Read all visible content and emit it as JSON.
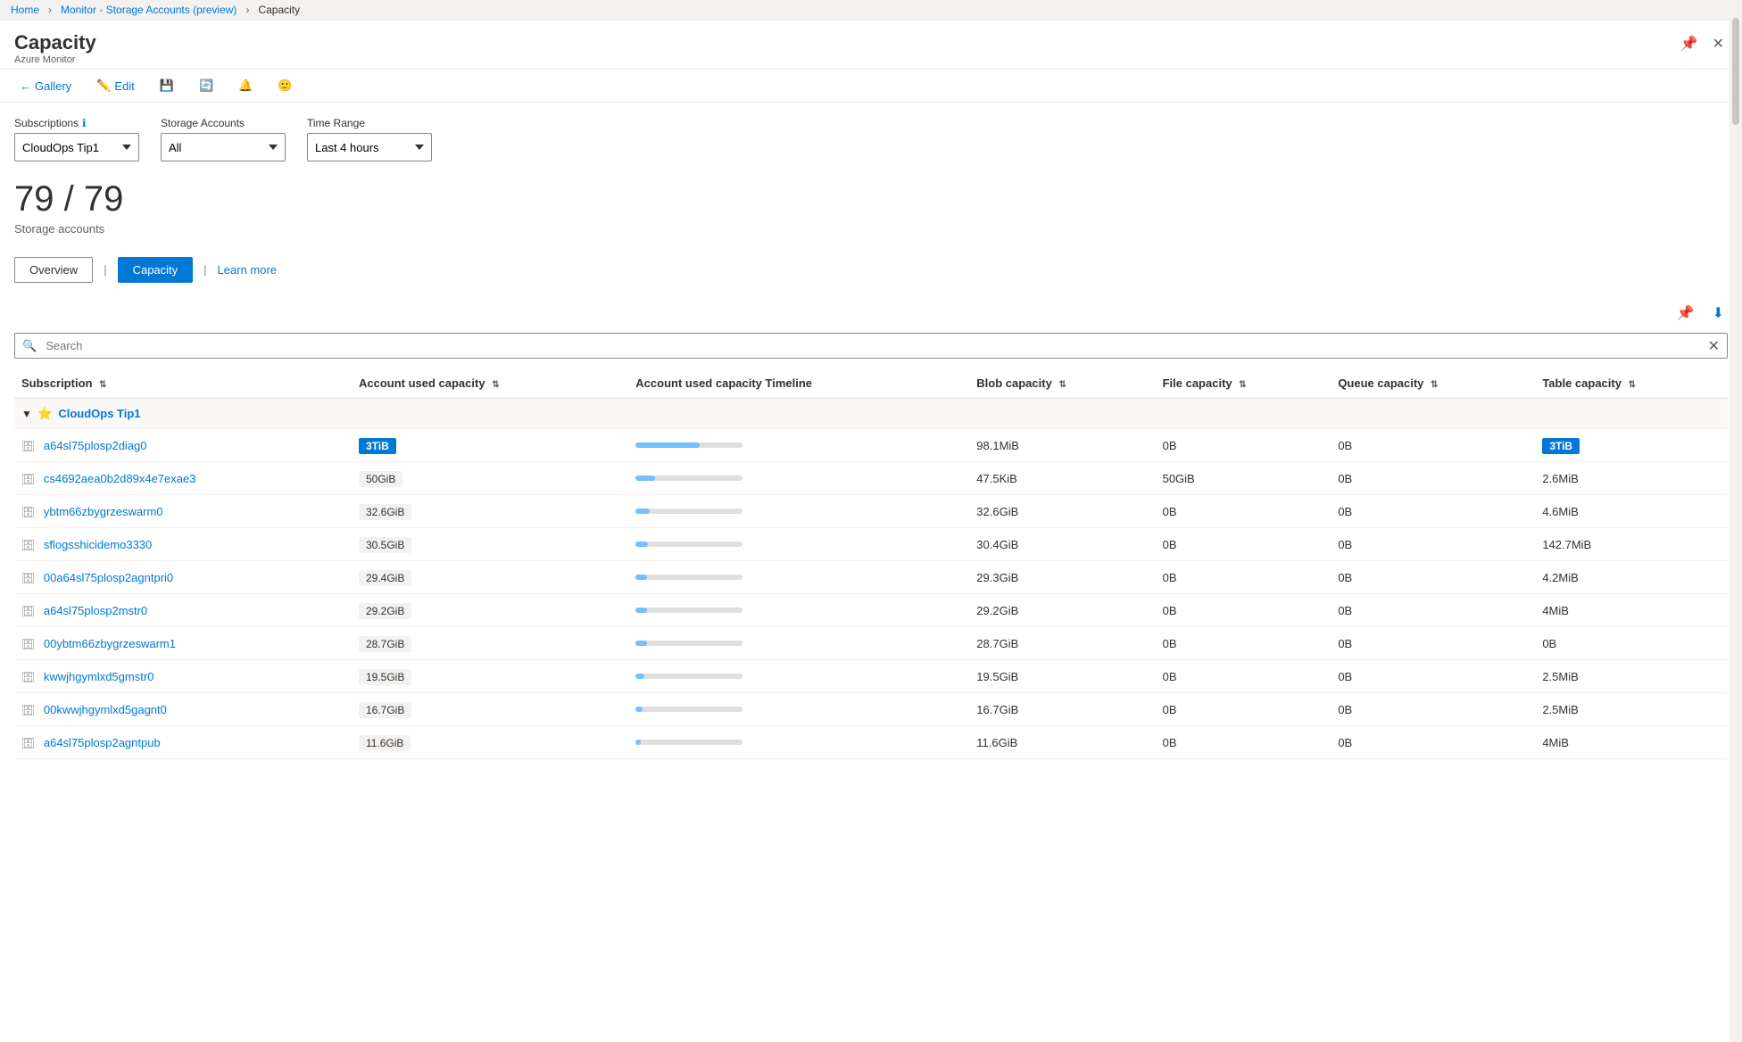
{
  "breadcrumb": {
    "home": "Home",
    "monitor": "Monitor - Storage Accounts (preview)",
    "current": "Capacity"
  },
  "header": {
    "title": "Capacity",
    "subtitle": "Azure Monitor"
  },
  "toolbar": {
    "gallery": "Gallery",
    "edit": "Edit"
  },
  "filters": {
    "subscriptions_label": "Subscriptions",
    "subscriptions_value": "CloudOps Tip1",
    "storage_accounts_label": "Storage Accounts",
    "storage_accounts_value": "All",
    "time_range_label": "Time Range",
    "time_range_value": "Last 4 hours"
  },
  "count": {
    "value": "79 / 79",
    "label": "Storage accounts"
  },
  "tabs": {
    "overview": "Overview",
    "capacity": "Capacity",
    "learn_more": "Learn more"
  },
  "search": {
    "placeholder": "Search"
  },
  "table": {
    "columns": [
      "Subscription",
      "Account used capacity",
      "Account used capacity Timeline",
      "Blob capacity",
      "File capacity",
      "Queue capacity",
      "Table capacity"
    ],
    "group": {
      "name": "CloudOps Tip1"
    },
    "rows": [
      {
        "name": "a64sl75plosp2diag0",
        "used_capacity": "3TiB",
        "used_capacity_highlight": true,
        "timeline_fill": 60,
        "blob_capacity": "98.1MiB",
        "file_capacity": "0B",
        "queue_capacity": "0B",
        "table_capacity": "3TiB",
        "table_capacity_highlight": true
      },
      {
        "name": "cs4692aea0b2d89x4e7exae3",
        "used_capacity": "50GiB",
        "used_capacity_highlight": false,
        "timeline_fill": 18,
        "blob_capacity": "47.5KiB",
        "file_capacity": "50GiB",
        "queue_capacity": "0B",
        "table_capacity": "2.6MiB",
        "table_capacity_highlight": false
      },
      {
        "name": "ybtm66zbygrzeswarm0",
        "used_capacity": "32.6GiB",
        "used_capacity_highlight": false,
        "timeline_fill": 13,
        "blob_capacity": "32.6GiB",
        "file_capacity": "0B",
        "queue_capacity": "0B",
        "table_capacity": "4.6MiB",
        "table_capacity_highlight": false
      },
      {
        "name": "sflogsshicidemo3330",
        "used_capacity": "30.5GiB",
        "used_capacity_highlight": false,
        "timeline_fill": 12,
        "blob_capacity": "30.4GiB",
        "file_capacity": "0B",
        "queue_capacity": "0B",
        "table_capacity": "142.7MiB",
        "table_capacity_highlight": false
      },
      {
        "name": "00a64sl75plosp2agntpri0",
        "used_capacity": "29.4GiB",
        "used_capacity_highlight": false,
        "timeline_fill": 11,
        "blob_capacity": "29.3GiB",
        "file_capacity": "0B",
        "queue_capacity": "0B",
        "table_capacity": "4.2MiB",
        "table_capacity_highlight": false
      },
      {
        "name": "a64sl75plosp2mstr0",
        "used_capacity": "29.2GiB",
        "used_capacity_highlight": false,
        "timeline_fill": 11,
        "blob_capacity": "29.2GiB",
        "file_capacity": "0B",
        "queue_capacity": "0B",
        "table_capacity": "4MiB",
        "table_capacity_highlight": false
      },
      {
        "name": "00ybtm66zbygrzeswarm1",
        "used_capacity": "28.7GiB",
        "used_capacity_highlight": false,
        "timeline_fill": 11,
        "blob_capacity": "28.7GiB",
        "file_capacity": "0B",
        "queue_capacity": "0B",
        "table_capacity": "0B",
        "table_capacity_highlight": false
      },
      {
        "name": "kwwjhgymlxd5gmstr0",
        "used_capacity": "19.5GiB",
        "used_capacity_highlight": false,
        "timeline_fill": 8,
        "blob_capacity": "19.5GiB",
        "file_capacity": "0B",
        "queue_capacity": "0B",
        "table_capacity": "2.5MiB",
        "table_capacity_highlight": false
      },
      {
        "name": "00kwwjhgymlxd5gagnt0",
        "used_capacity": "16.7GiB",
        "used_capacity_highlight": false,
        "timeline_fill": 7,
        "blob_capacity": "16.7GiB",
        "file_capacity": "0B",
        "queue_capacity": "0B",
        "table_capacity": "2.5MiB",
        "table_capacity_highlight": false
      },
      {
        "name": "a64sl75plosp2agntpub",
        "used_capacity": "11.6GiB",
        "used_capacity_highlight": false,
        "timeline_fill": 5,
        "blob_capacity": "11.6GiB",
        "file_capacity": "0B",
        "queue_capacity": "0B",
        "table_capacity": "4MiB",
        "table_capacity_highlight": false
      }
    ]
  },
  "colors": {
    "accent": "#0078d4",
    "highlight_bg": "#0078d4",
    "timeline_color": "#74c0fc",
    "text_link": "#0078d4"
  }
}
